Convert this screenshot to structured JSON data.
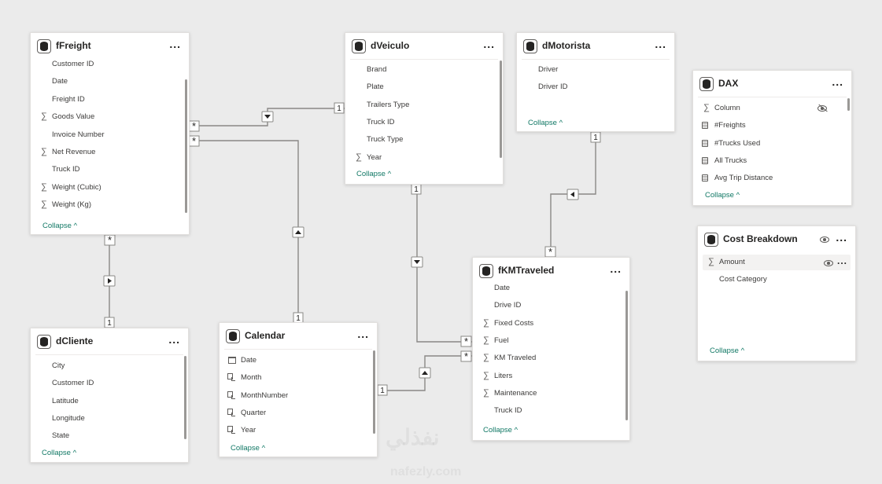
{
  "tables": {
    "ffreight": {
      "title": "fFreight",
      "more": "...",
      "fields": [
        {
          "icon": "",
          "name": "Customer ID"
        },
        {
          "icon": "",
          "name": "Date"
        },
        {
          "icon": "",
          "name": "Freight ID"
        },
        {
          "icon": "sigma-icon",
          "name": "Goods Value"
        },
        {
          "icon": "",
          "name": "Invoice Number"
        },
        {
          "icon": "sigma-icon",
          "name": "Net Revenue"
        },
        {
          "icon": "",
          "name": "Truck ID"
        },
        {
          "icon": "sigma-icon",
          "name": "Weight (Cubic)"
        },
        {
          "icon": "sigma-icon",
          "name": "Weight (Kg)"
        }
      ],
      "collapse": "Collapse ^"
    },
    "dveiculo": {
      "title": "dVeiculo",
      "more": "...",
      "fields": [
        {
          "icon": "",
          "name": "Brand"
        },
        {
          "icon": "",
          "name": "Plate"
        },
        {
          "icon": "",
          "name": "Trailers Type"
        },
        {
          "icon": "",
          "name": "Truck ID"
        },
        {
          "icon": "",
          "name": "Truck Type"
        },
        {
          "icon": "sigma-icon",
          "name": "Year"
        }
      ],
      "collapse": "Collapse ^"
    },
    "dmotorista": {
      "title": "dMotorista",
      "more": "...",
      "fields": [
        {
          "icon": "",
          "name": "Driver"
        },
        {
          "icon": "",
          "name": "Driver ID"
        }
      ],
      "collapse": "Collapse ^"
    },
    "dax": {
      "title": "DAX",
      "more": "...",
      "fields": [
        {
          "icon": "sigma-icon",
          "name": "Column"
        },
        {
          "icon": "calculator-icon",
          "name": "#Freights"
        },
        {
          "icon": "calculator-icon",
          "name": "#Trucks Used"
        },
        {
          "icon": "calculator-icon",
          "name": "All Trucks"
        },
        {
          "icon": "calculator-icon",
          "name": "Avg Trip Distance"
        }
      ],
      "collapse": "Collapse ^"
    },
    "cost": {
      "title": "Cost Breakdown",
      "more": "...",
      "fields": [
        {
          "icon": "sigma-icon",
          "name": "Amount"
        },
        {
          "icon": "",
          "name": "Cost Category"
        }
      ],
      "collapse": "Collapse ^"
    },
    "dcliente": {
      "title": "dCliente",
      "more": "...",
      "fields": [
        {
          "icon": "",
          "name": "City"
        },
        {
          "icon": "",
          "name": "Customer ID"
        },
        {
          "icon": "",
          "name": "Latitude"
        },
        {
          "icon": "",
          "name": "Longitude"
        },
        {
          "icon": "",
          "name": "State"
        }
      ],
      "collapse": "Collapse ^"
    },
    "calendar": {
      "title": "Calendar",
      "more": "...",
      "fields": [
        {
          "icon": "calendar-icon",
          "name": "Date"
        },
        {
          "icon": "hierarchy-icon",
          "name": "Month"
        },
        {
          "icon": "hierarchy-icon",
          "name": "MonthNumber"
        },
        {
          "icon": "hierarchy-icon",
          "name": "Quarter"
        },
        {
          "icon": "hierarchy-icon",
          "name": "Year"
        }
      ],
      "collapse": "Collapse ^"
    },
    "fkm": {
      "title": "fKMTraveled",
      "more": "...",
      "fields": [
        {
          "icon": "",
          "name": "Date"
        },
        {
          "icon": "",
          "name": "Drive ID"
        },
        {
          "icon": "sigma-icon",
          "name": "Fixed Costs"
        },
        {
          "icon": "sigma-icon",
          "name": "Fuel"
        },
        {
          "icon": "sigma-icon",
          "name": "KM Traveled"
        },
        {
          "icon": "sigma-icon",
          "name": "Liters"
        },
        {
          "icon": "sigma-icon",
          "name": "Maintenance"
        },
        {
          "icon": "",
          "name": "Truck ID"
        }
      ],
      "collapse": "Collapse ^"
    }
  },
  "relationships": {
    "one": "1",
    "many": "*"
  },
  "watermark": {
    "line1": "نفذلي",
    "line2": "nafezly.com"
  }
}
